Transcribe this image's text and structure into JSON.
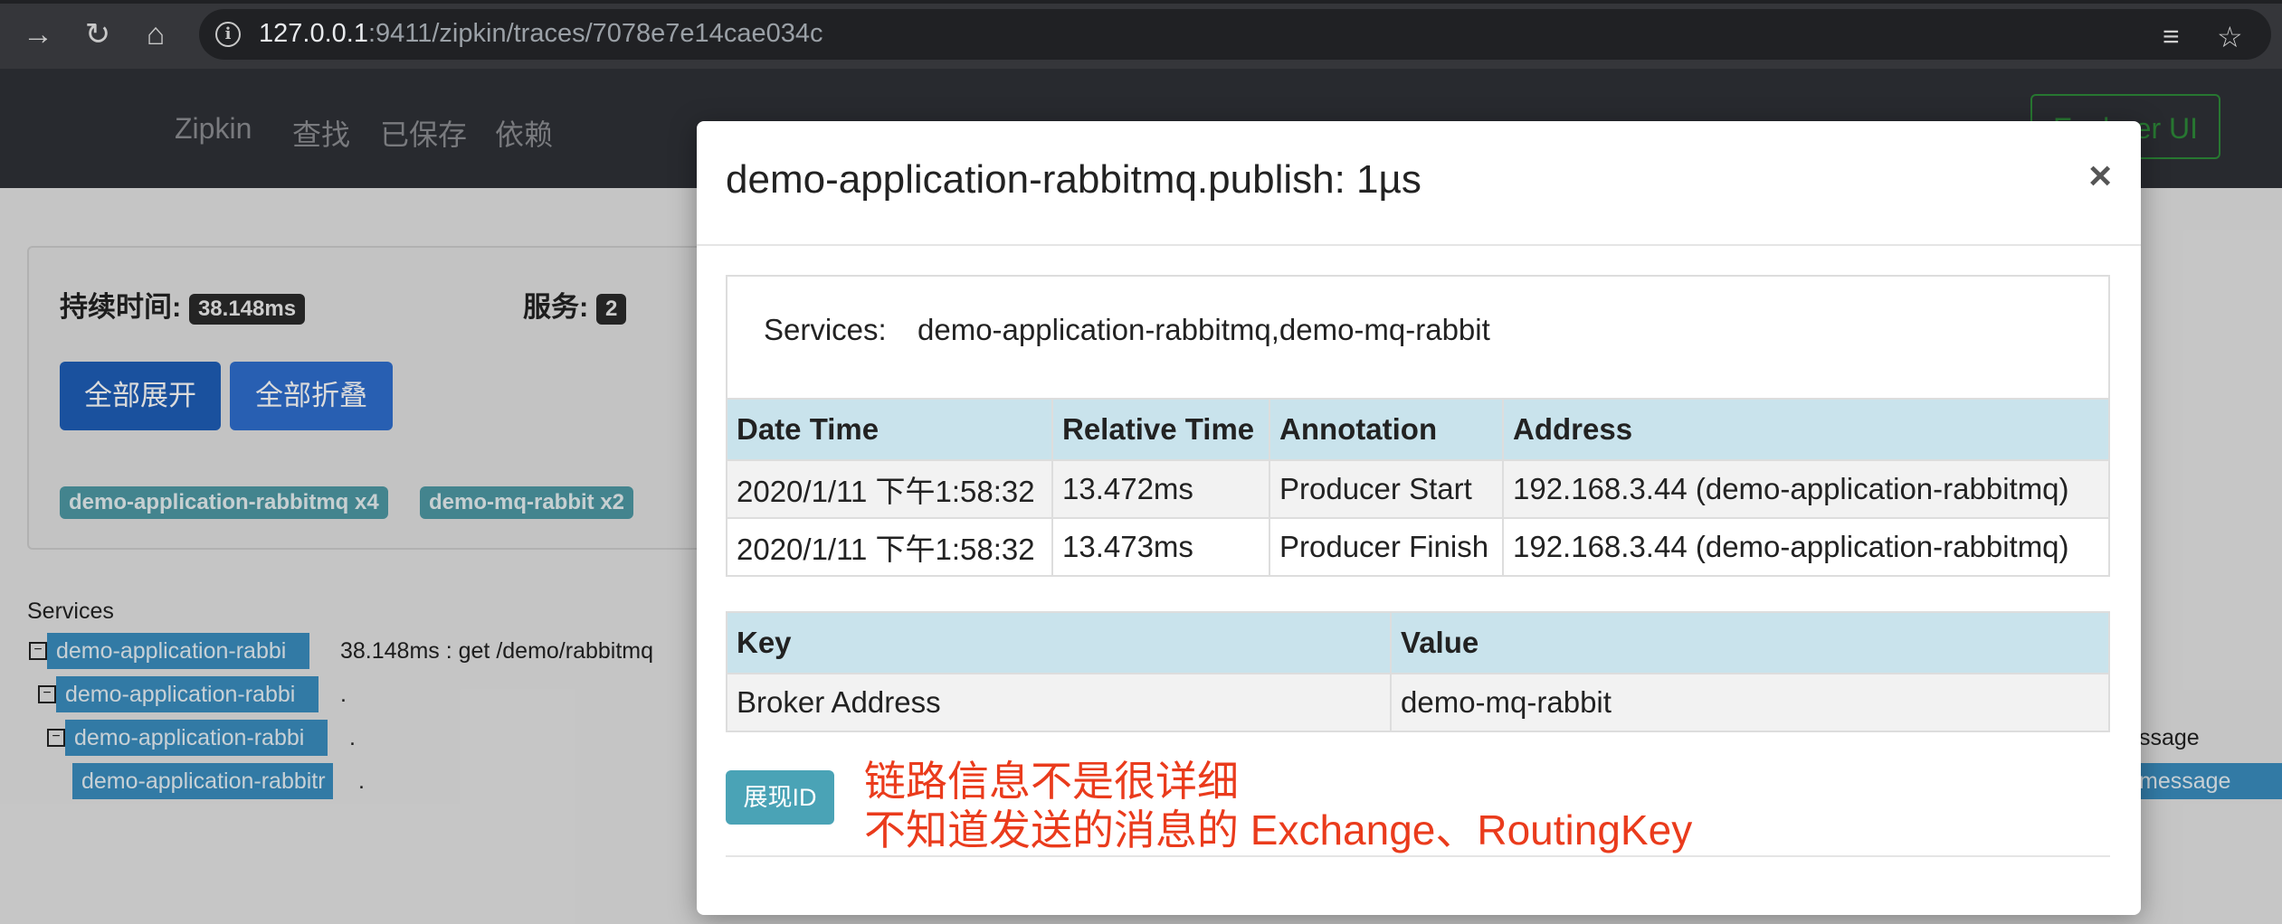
{
  "browser": {
    "url_host": "127.0.0.1",
    "url_rest": ":9411/zipkin/traces/7078e7e14cae034c"
  },
  "navbar": {
    "brand": "Zipkin",
    "links": [
      "查找",
      "已保存",
      "依赖"
    ],
    "explorer_button": "Explorer UI"
  },
  "summary": {
    "duration_label": "持续时间:",
    "duration_value": "38.148ms",
    "services_label": "服务:",
    "services_value": "2",
    "expand_all": "全部展开",
    "collapse_all": "全部折叠",
    "service_badges": [
      "demo-application-rabbitmq x4",
      "demo-mq-rabbit x2"
    ]
  },
  "trace_tree": {
    "header": "Services",
    "rows": [
      {
        "service": "demo-application-rabbi",
        "text": "38.148ms : get /demo/rabbitmq"
      },
      {
        "service": "demo-application-rabbi",
        "text": "."
      },
      {
        "service": "demo-application-rabbi",
        "text": "."
      },
      {
        "service": "demo-application-rabbitr",
        "text": "."
      }
    ],
    "right_rows": [
      "ssage",
      "message"
    ]
  },
  "modal": {
    "title": "demo-application-rabbitmq.publish: 1µs",
    "close": "×",
    "services_label": "Services:",
    "services_value": "demo-application-rabbitmq,demo-mq-rabbit",
    "annotations": {
      "headers": [
        "Date Time",
        "Relative Time",
        "Annotation",
        "Address"
      ],
      "rows": [
        [
          "2020/1/11 下午1:58:32",
          "13.472ms",
          "Producer Start",
          "192.168.3.44 (demo-application-rabbitmq)"
        ],
        [
          "2020/1/11 下午1:58:32",
          "13.473ms",
          "Producer Finish",
          "192.168.3.44 (demo-application-rabbitmq)"
        ]
      ]
    },
    "tags": {
      "headers": [
        "Key",
        "Value"
      ],
      "rows": [
        [
          "Broker Address",
          "demo-mq-rabbit"
        ]
      ]
    },
    "show_id_button": "展现ID",
    "annotation_note": [
      "链路信息不是很详细",
      "不知道发送的消息的 Exchange、RoutingKey"
    ]
  },
  "colors": {
    "accent": "#4aa3b6",
    "note": "#ea3b1c",
    "table_header": "#c9e3ec"
  }
}
